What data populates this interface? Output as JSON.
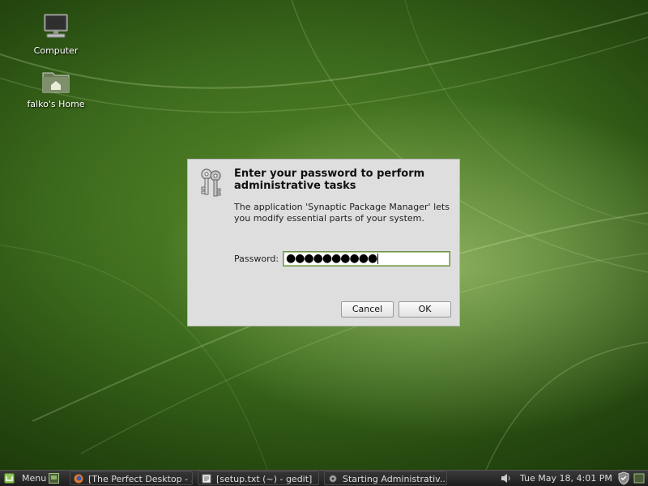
{
  "desktop": {
    "icons": [
      {
        "label": "Computer",
        "icon": "computer-icon"
      },
      {
        "label": "falko's Home",
        "icon": "home-folder-icon"
      }
    ]
  },
  "dialog": {
    "title": "Enter your password to perform administrative tasks",
    "description": "The application 'Synaptic Package Manager' lets you modify essential parts of your system.",
    "password_label": "Password:",
    "password_value": "●●●●●●●●●●",
    "cancel_label": "Cancel",
    "ok_label": "OK",
    "icon": "keys-icon"
  },
  "taskbar": {
    "menu_label": "Menu",
    "tasks": [
      {
        "label": "[The Perfect Desktop - ...",
        "icon": "firefox-icon"
      },
      {
        "label": "[setup.txt (~) - gedit]",
        "icon": "text-editor-icon"
      },
      {
        "label": "Starting Administrativ...",
        "icon": "gear-icon"
      }
    ],
    "clock": "Tue May 18,  4:01 PM",
    "tray_icons": [
      "volume-icon",
      "shield-update-icon"
    ]
  },
  "colors": {
    "accent": "#6e8f4a",
    "desktop_green": "#3c6a1c",
    "taskbar": "#262626"
  }
}
